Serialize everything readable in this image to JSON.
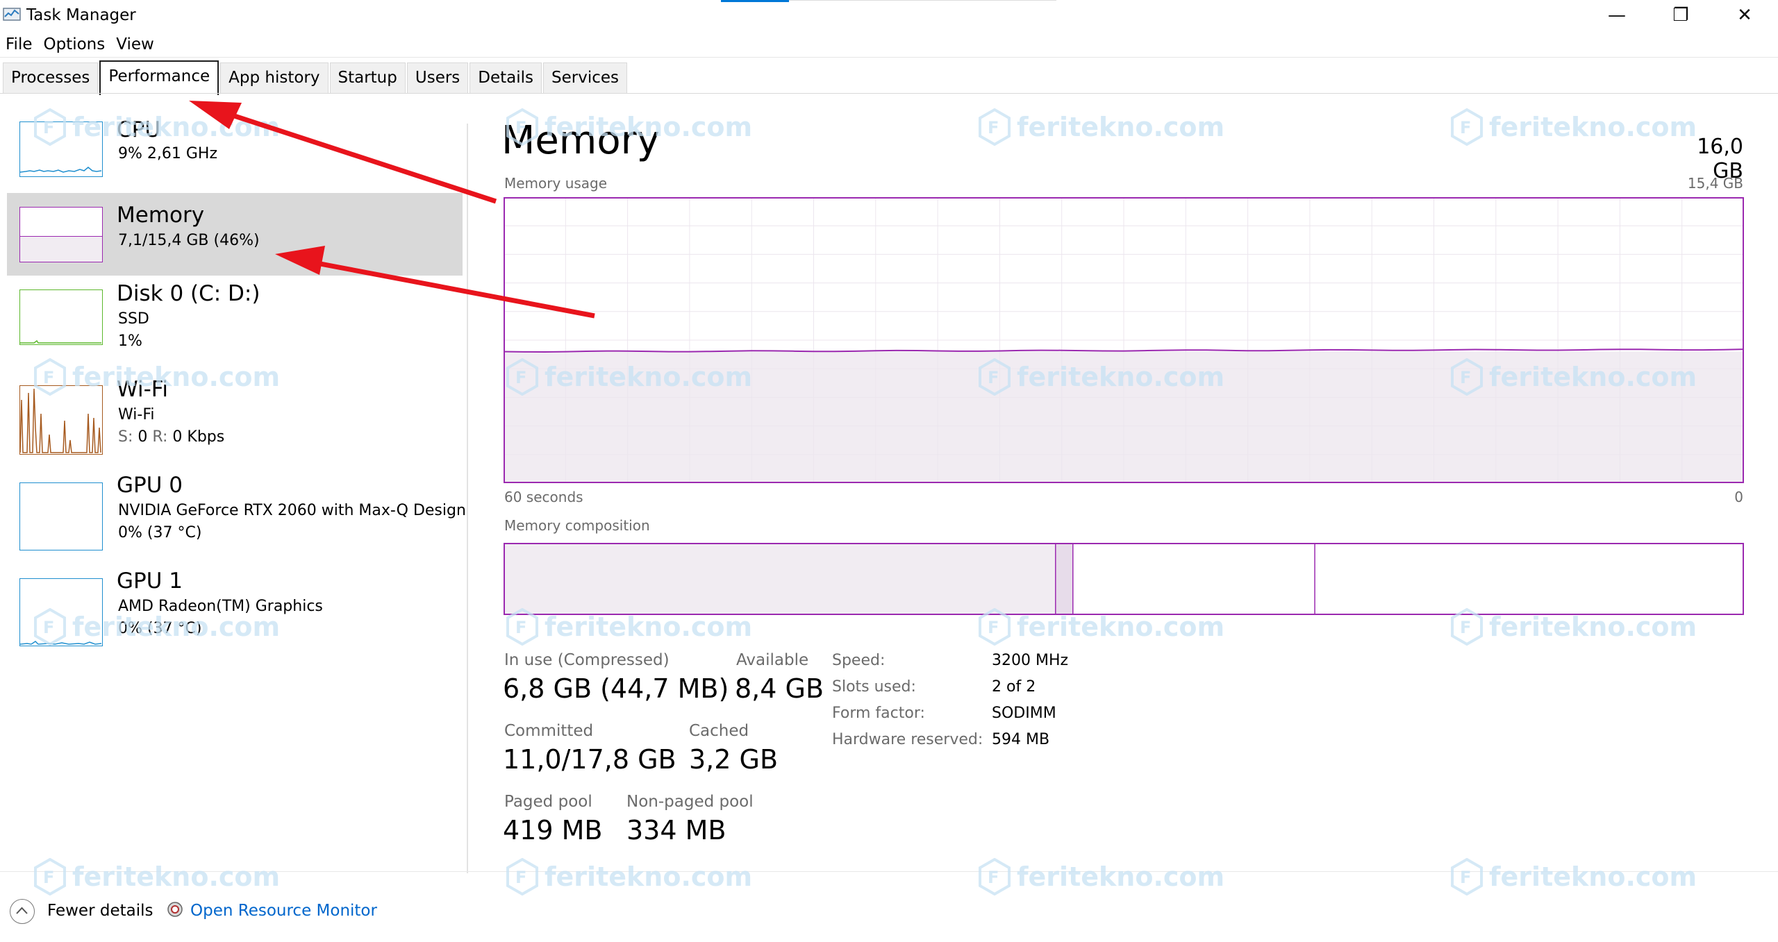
{
  "window": {
    "title": "Task Manager",
    "minimize_glyph": "—",
    "maximize_glyph": "❐",
    "close_glyph": "✕"
  },
  "menu": [
    "File",
    "Options",
    "View"
  ],
  "tabs": [
    {
      "label": "Processes",
      "active": false
    },
    {
      "label": "Performance",
      "active": true
    },
    {
      "label": "App history",
      "active": false
    },
    {
      "label": "Startup",
      "active": false
    },
    {
      "label": "Users",
      "active": false
    },
    {
      "label": "Details",
      "active": false
    },
    {
      "label": "Services",
      "active": false
    }
  ],
  "sidebar": {
    "items": [
      {
        "name": "CPU",
        "line1": "9%  2,61 GHz",
        "line2": "",
        "color": "#1f8fcf",
        "selected": false
      },
      {
        "name": "Memory",
        "line1": "7,1/15,4 GB (46%)",
        "line2": "",
        "color": "#9b29b0",
        "selected": true
      },
      {
        "name": "Disk 0 (C: D:)",
        "line1": "SSD",
        "line2": "1%",
        "color": "#5cb82c",
        "selected": false
      },
      {
        "name": "Wi-Fi",
        "line1": "Wi-Fi",
        "line2_label_s": "S:",
        "line2_value_s": "0",
        "line2_label_r": "R:",
        "line2_value_r": "0 Kbps",
        "color": "#a65a1f",
        "selected": false
      },
      {
        "name": "GPU 0",
        "line1": "NVIDIA GeForce RTX 2060 with Max-Q Design",
        "line2": "0%  (37 °C)",
        "color": "#1f8fcf",
        "selected": false
      },
      {
        "name": "GPU 1",
        "line1": "AMD Radeon(TM) Graphics",
        "line2": "0%  (37 °C)",
        "color": "#1f8fcf",
        "selected": false
      }
    ]
  },
  "memory": {
    "title": "Memory",
    "total": "16,0 GB",
    "usage_label": "Memory usage",
    "usage_max": "15,4 GB",
    "graph_left": "60 seconds",
    "graph_right": "0",
    "usage_fraction": 0.46,
    "composition_label": "Memory composition",
    "composition_in_use_fraction": 0.445,
    "composition_modified_fraction": 0.014,
    "composition_standby_fraction": 0.195,
    "stats": {
      "in_use_label": "In use (Compressed)",
      "in_use_value": "6,8 GB (44,7 MB)",
      "available_label": "Available",
      "available_value": "8,4 GB",
      "committed_label": "Committed",
      "committed_value": "11,0/17,8 GB",
      "cached_label": "Cached",
      "cached_value": "3,2 GB",
      "paged_label": "Paged pool",
      "paged_value": "419 MB",
      "nonpaged_label": "Non-paged pool",
      "nonpaged_value": "334 MB"
    },
    "specs": [
      {
        "label": "Speed:",
        "value": "3200 MHz"
      },
      {
        "label": "Slots used:",
        "value": "2 of 2"
      },
      {
        "label": "Form factor:",
        "value": "SODIMM"
      },
      {
        "label": "Hardware reserved:",
        "value": "594 MB"
      }
    ]
  },
  "footer": {
    "fewer_details": "Fewer details",
    "open_resource_monitor": "Open Resource Monitor"
  },
  "watermark": "feritekno.com",
  "colors": {
    "memory_accent": "#9b29b0",
    "memory_fill": "#f1ecf2",
    "selected_bg": "#d9d9d9",
    "arrow": "#e8141c",
    "link": "#0066cc"
  },
  "icons": {
    "app": "task-manager-icon",
    "fewer": "chevron-up-circle-icon",
    "resmon": "resource-monitor-icon"
  }
}
